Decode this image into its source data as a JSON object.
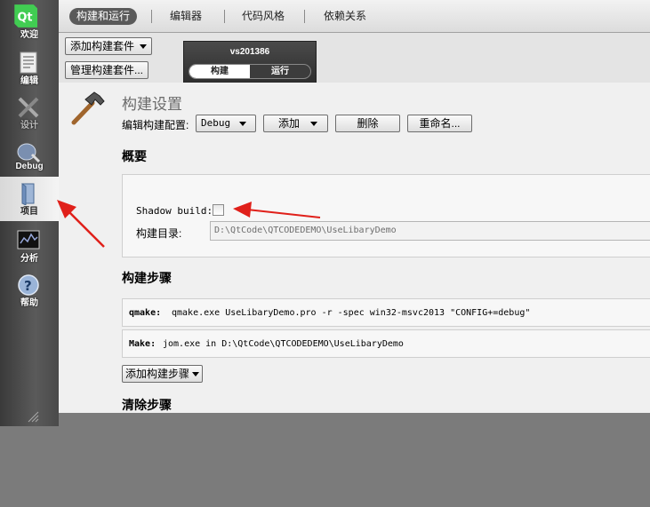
{
  "modebar": {
    "items": [
      {
        "label": "欢迎",
        "icon": "qt-logo-icon"
      },
      {
        "label": "编辑",
        "icon": "edit-document-icon"
      },
      {
        "label": "设计",
        "icon": "design-tools-icon"
      },
      {
        "label": "Debug",
        "icon": "debug-bug-icon"
      },
      {
        "label": "项目",
        "icon": "project-book-icon"
      },
      {
        "label": "分析",
        "icon": "analyze-monitor-icon"
      },
      {
        "label": "帮助",
        "icon": "help-question-icon"
      }
    ],
    "logo_text": "Qt"
  },
  "tabs": [
    {
      "label": "构建和运行"
    },
    {
      "label": "编辑器"
    },
    {
      "label": "代码风格"
    },
    {
      "label": "依赖关系"
    }
  ],
  "kit": {
    "add_kit": "添加构建套件",
    "manage_kits": "管理构建套件...",
    "target_name": "vs201386",
    "seg_build": "构建",
    "seg_run": "运行"
  },
  "build_settings": {
    "title": "构建设置",
    "edit_config_label": "编辑构建配置:",
    "config_value": "Debug",
    "add": "添加",
    "delete": "删除",
    "rename": "重命名..."
  },
  "overview": {
    "title": "概要",
    "shadow_build_label": "Shadow build:",
    "shadow_build_checked": false,
    "build_dir_label": "构建目录:",
    "build_dir_value": "D:\\QtCode\\QTCODEDEMO\\UseLibaryDemo"
  },
  "build_steps": {
    "title": "构建步骤",
    "steps": [
      {
        "name": "qmake:",
        "command": "qmake.exe UseLibaryDemo.pro -r -spec win32-msvc2013 \"CONFIG+=debug\""
      },
      {
        "name": "Make:",
        "command": "jom.exe in D:\\QtCode\\QTCODEDEMO\\UseLibaryDemo"
      }
    ],
    "add_step": "添加构建步骤"
  },
  "clean_steps": {
    "title": "清除步骤"
  },
  "colors": {
    "annotation_arrow": "#e0201a",
    "active_tab": "#5a5a5a"
  }
}
